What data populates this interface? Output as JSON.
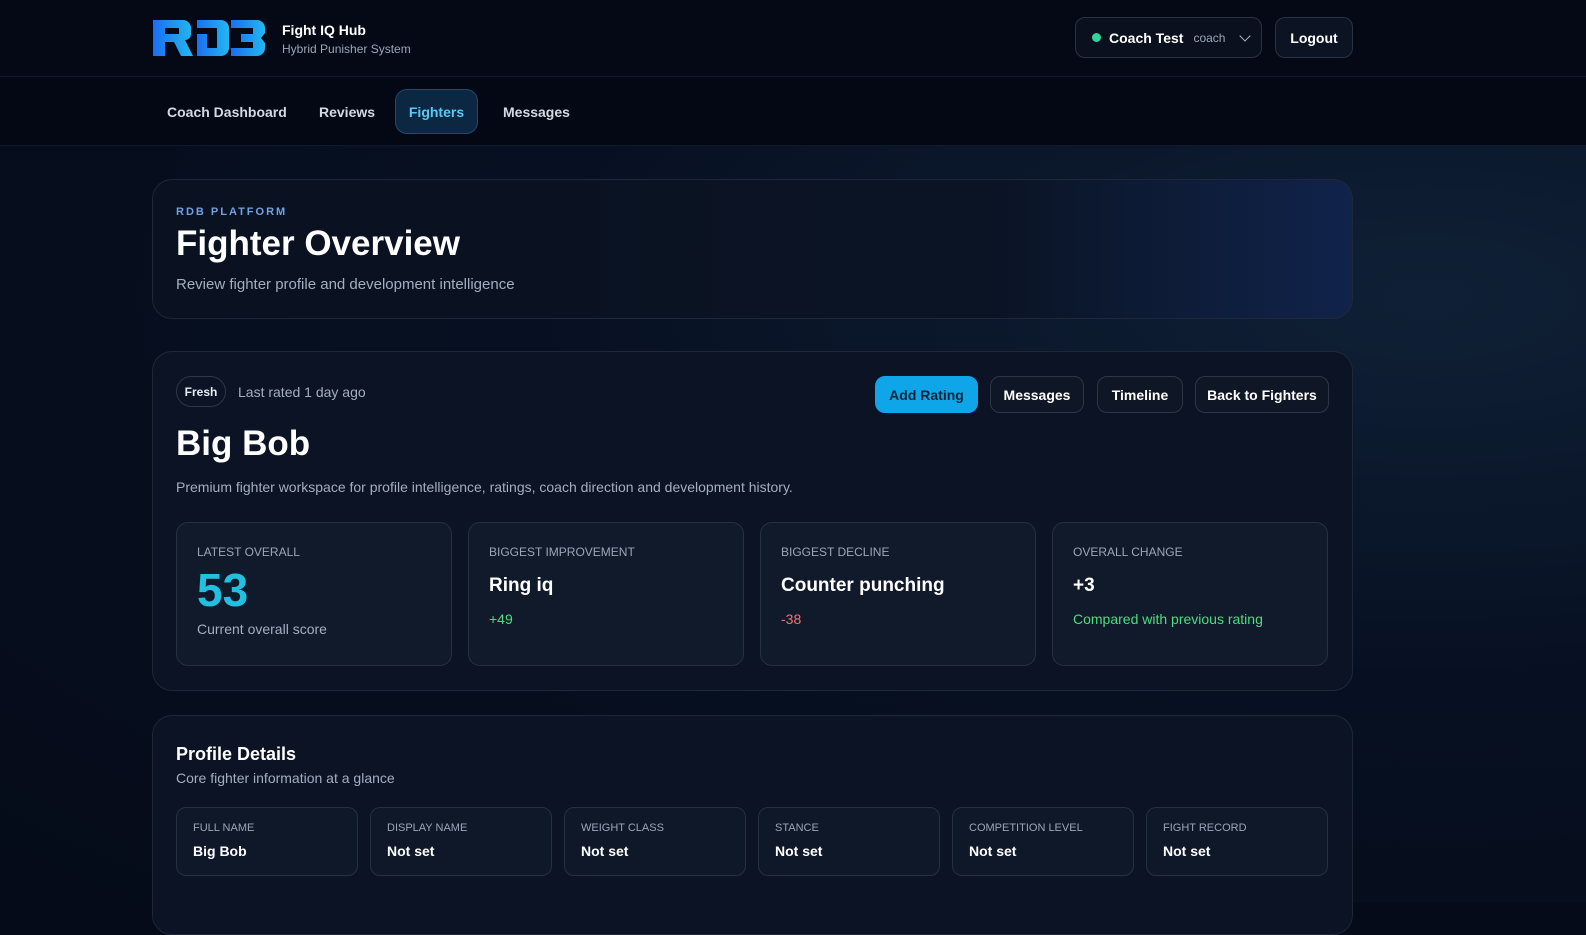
{
  "app": {
    "logo_text": "RDB",
    "title": "Fight IQ Hub",
    "subtitle": "Hybrid Punisher System"
  },
  "user": {
    "name": "Coach Test",
    "role": "coach",
    "logout": "Logout"
  },
  "nav": [
    {
      "label": "Coach Dashboard"
    },
    {
      "label": "Reviews"
    },
    {
      "label": "Fighters"
    },
    {
      "label": "Messages"
    }
  ],
  "hero": {
    "eyebrow": "RDB PLATFORM",
    "title": "Fighter Overview",
    "subtitle": "Review fighter profile and development intelligence"
  },
  "fighter": {
    "badge": "Fresh",
    "last_rated": "Last rated 1 day ago",
    "name": "Big Bob",
    "description": "Premium fighter workspace for profile intelligence, ratings, coach direction and development history.",
    "actions": {
      "add_rating": "Add Rating",
      "messages": "Messages",
      "timeline": "Timeline",
      "back": "Back to Fighters"
    },
    "stats": [
      {
        "label": "LATEST OVERALL",
        "value": "53",
        "sub": "Current overall score"
      },
      {
        "label": "BIGGEST IMPROVEMENT",
        "value": "Ring iq",
        "sub": "+49"
      },
      {
        "label": "BIGGEST DECLINE",
        "value": "Counter punching",
        "sub": "-38"
      },
      {
        "label": "OVERALL CHANGE",
        "value": "+3",
        "sub": "Compared with previous rating"
      }
    ]
  },
  "profile": {
    "title": "Profile Details",
    "subtitle": "Core fighter information at a glance",
    "fields": [
      {
        "label": "FULL NAME",
        "value": "Big Bob"
      },
      {
        "label": "DISPLAY NAME",
        "value": "Not set"
      },
      {
        "label": "WEIGHT CLASS",
        "value": "Not set"
      },
      {
        "label": "STANCE",
        "value": "Not set"
      },
      {
        "label": "COMPETITION LEVEL",
        "value": "Not set"
      },
      {
        "label": "FIGHT RECORD",
        "value": "Not set"
      }
    ]
  },
  "colors": {
    "accent": "#0ea5e9",
    "positive": "#4ade80",
    "negative": "#f87171",
    "score": "#22c0e0"
  }
}
